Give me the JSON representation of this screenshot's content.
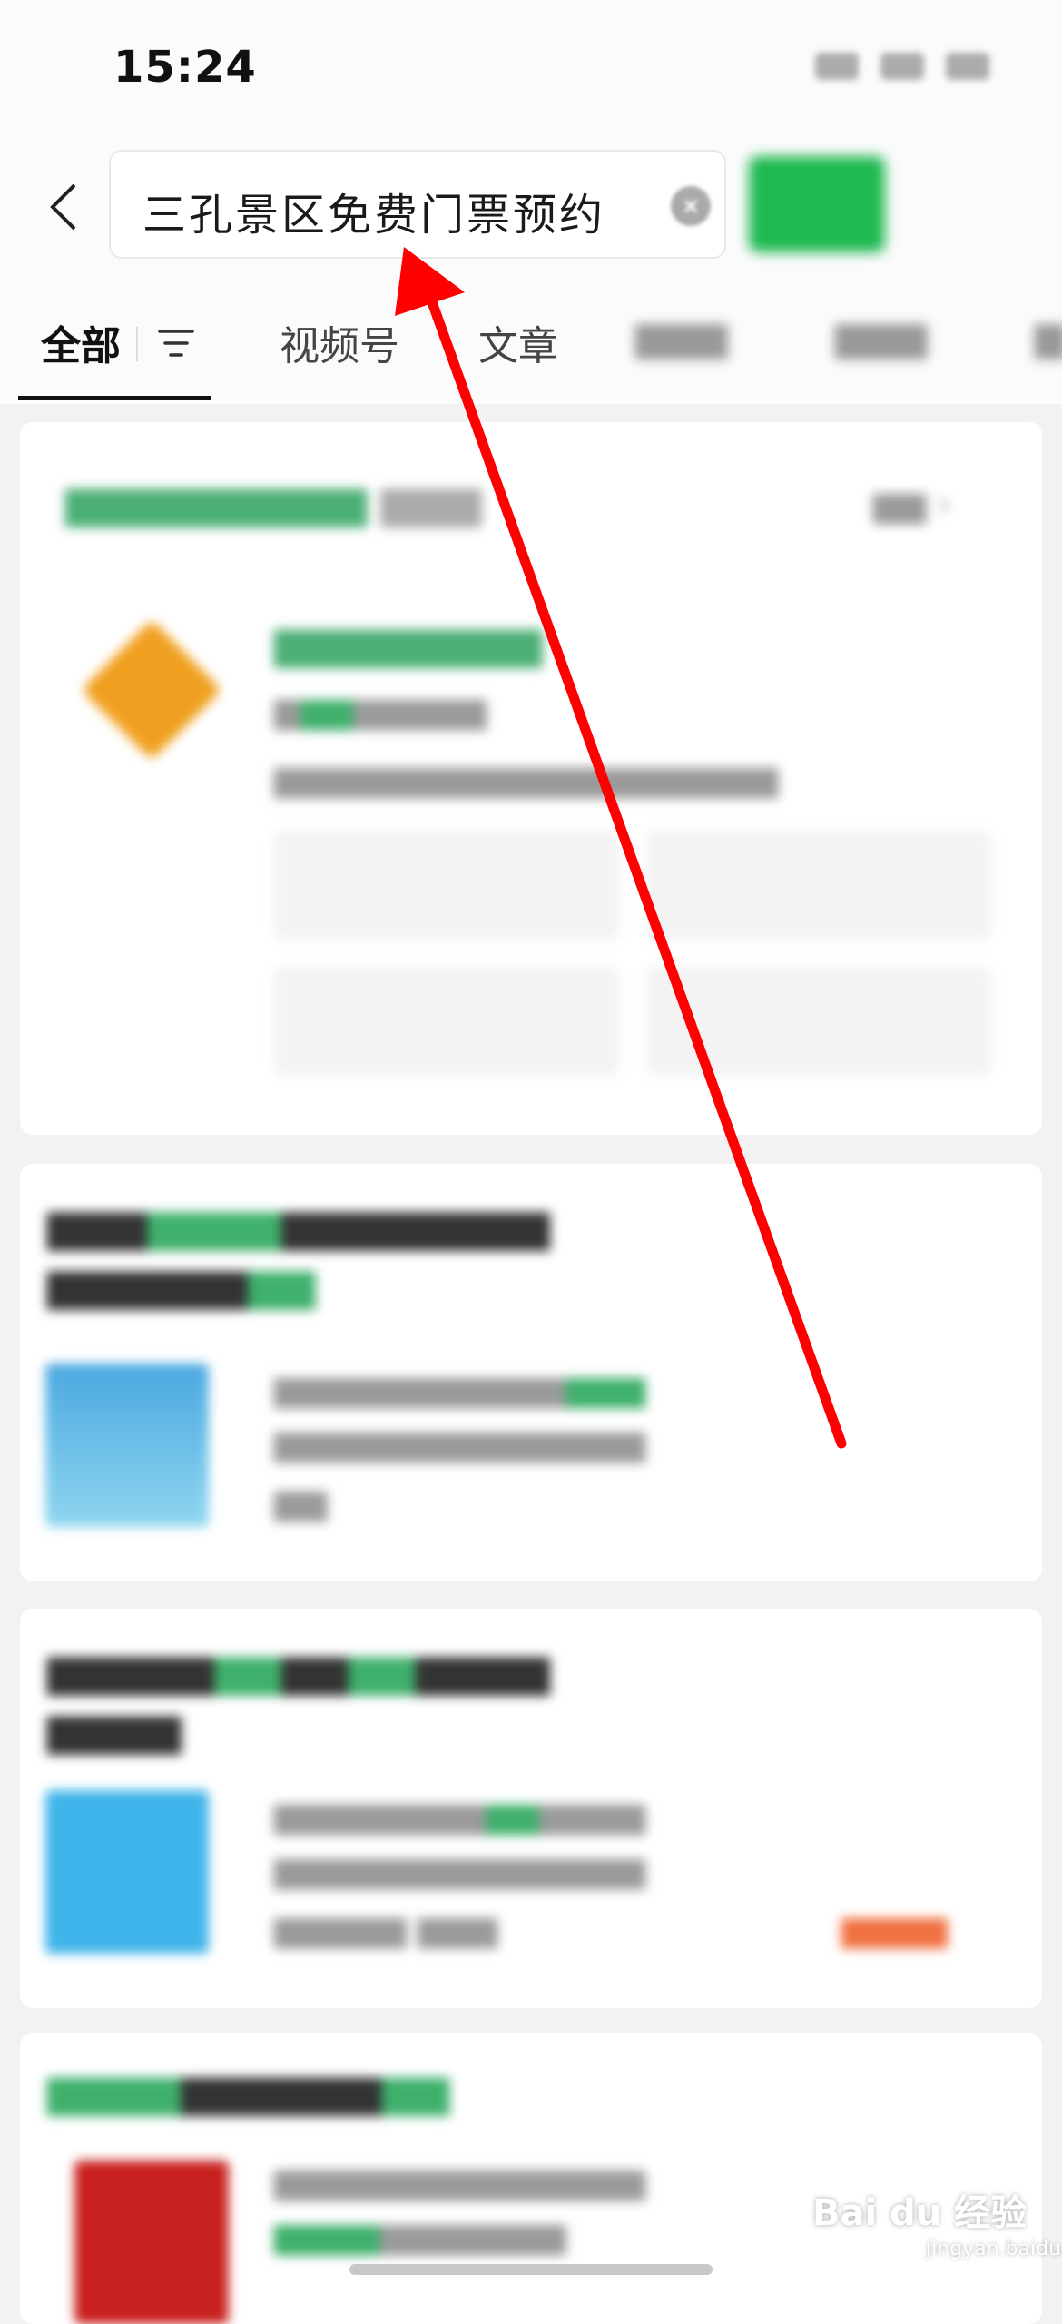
{
  "status_bar": {
    "time": "15:24"
  },
  "search": {
    "query": "三孔景区免费门票预约"
  },
  "tabs": [
    {
      "label": "全部"
    },
    {
      "label": "视频号"
    },
    {
      "label": "文章"
    }
  ],
  "colors": {
    "accent_green": "#1eb950",
    "annotation_red": "#ff0000"
  },
  "icons": [
    "back-arrow-icon",
    "clear-icon",
    "filter-icon"
  ],
  "watermark": {
    "text": "Bai du 经验",
    "sub": "jingyan.baidu.com"
  }
}
